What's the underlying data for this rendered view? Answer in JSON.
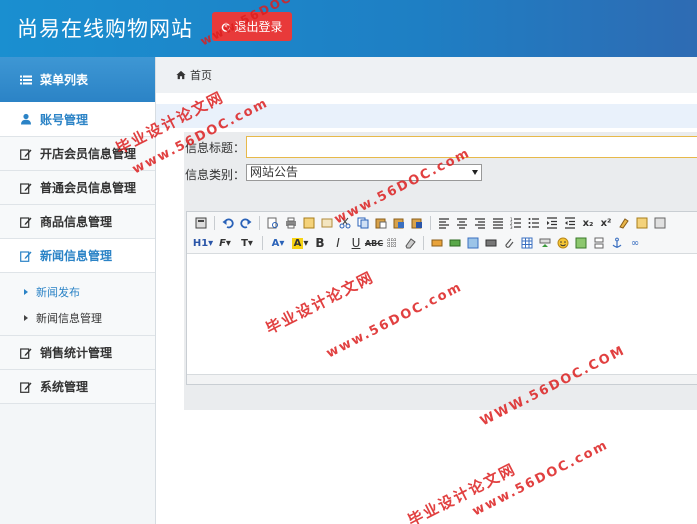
{
  "header": {
    "title": "尚易在线购物网站",
    "logout_label": "退出登录"
  },
  "sidebar": {
    "menu_title": "菜单列表",
    "items": [
      {
        "label": "账号管理"
      },
      {
        "label": "开店会员信息管理"
      },
      {
        "label": "普通会员信息管理"
      },
      {
        "label": "商品信息管理"
      },
      {
        "label": "新闻信息管理"
      },
      {
        "label": "销售统计管理"
      },
      {
        "label": "系统管理"
      }
    ],
    "sub_items": [
      {
        "label": "新闻发布"
      },
      {
        "label": "新闻信息管理"
      }
    ]
  },
  "breadcrumb": {
    "home": "首页"
  },
  "form": {
    "title_label": "信息标题：",
    "title_value": "",
    "category_label": "信息类别：",
    "category_value": "网站公告"
  },
  "editor": {
    "heading_btn": "H1",
    "font_btn": "F",
    "size_btn": "T",
    "sub_btn": "x₂",
    "sup_btn": "x²"
  },
  "watermark": {
    "line1": "毕业设计论文网",
    "line2": "www.56DOC.com",
    "line3": "WWW.56DOC.COM"
  },
  "colors": {
    "header": "#1a8fd0",
    "accent": "#2b83c6",
    "logout": "#e83a3a"
  }
}
